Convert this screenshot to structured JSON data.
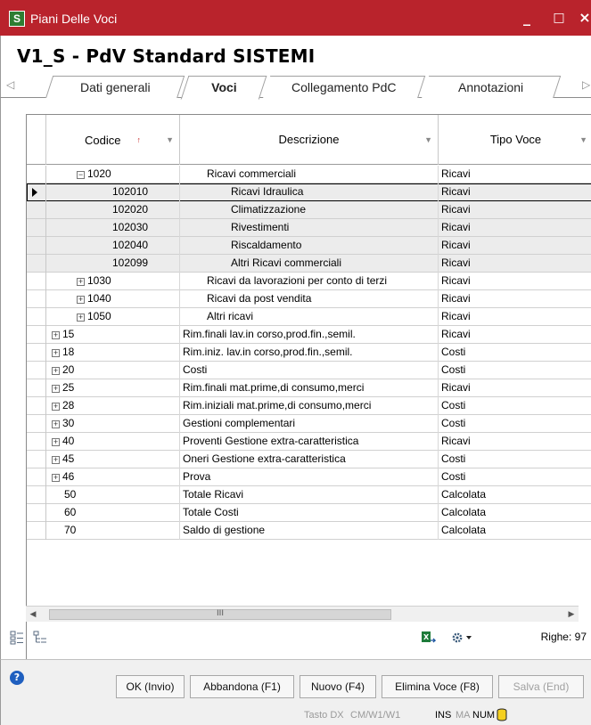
{
  "window": {
    "title": "Piani Delle Voci",
    "app_icon_letter": "S",
    "minimize": "_",
    "maximize": "□",
    "close": "×"
  },
  "heading": "V1_S - PdV Standard SISTEMI",
  "tabs": [
    {
      "label": "Dati generali",
      "active": false
    },
    {
      "label": "Voci",
      "active": true
    },
    {
      "label": "Collegamento PdC",
      "active": false
    },
    {
      "label": "Annotazioni",
      "active": false
    }
  ],
  "tabs_scroll": {
    "left": "◁",
    "right": "▷"
  },
  "grid": {
    "columns": {
      "codice": "Codice",
      "descrizione": "Descrizione",
      "tipo": "Tipo Voce"
    },
    "sort_indicator": "↑",
    "filter_indicator": "▼",
    "rows": [
      {
        "code": "1020",
        "desc": "Ricavi commerciali",
        "tipo": "Ricavi",
        "expander": "⊟",
        "level": 1,
        "child": false,
        "current": false
      },
      {
        "code": "102010",
        "desc": "Ricavi Idraulica",
        "tipo": "Ricavi",
        "expander": "",
        "level": 2,
        "child": true,
        "current": true
      },
      {
        "code": "102020",
        "desc": "Climatizzazione",
        "tipo": "Ricavi",
        "expander": "",
        "level": 2,
        "child": true,
        "current": false
      },
      {
        "code": "102030",
        "desc": "Rivestimenti",
        "tipo": "Ricavi",
        "expander": "",
        "level": 2,
        "child": true,
        "current": false
      },
      {
        "code": "102040",
        "desc": "Riscaldamento",
        "tipo": "Ricavi",
        "expander": "",
        "level": 2,
        "child": true,
        "current": false
      },
      {
        "code": "102099",
        "desc": "Altri Ricavi commerciali",
        "tipo": "Ricavi",
        "expander": "",
        "level": 2,
        "child": true,
        "current": false
      },
      {
        "code": "1030",
        "desc": "Ricavi da lavorazioni per conto di terzi",
        "tipo": "Ricavi",
        "expander": "⊞",
        "level": 1,
        "child": false,
        "current": false
      },
      {
        "code": "1040",
        "desc": "Ricavi da post vendita",
        "tipo": "Ricavi",
        "expander": "⊞",
        "level": 1,
        "child": false,
        "current": false
      },
      {
        "code": "1050",
        "desc": "Altri ricavi",
        "tipo": "Ricavi",
        "expander": "⊞",
        "level": 1,
        "child": false,
        "current": false
      },
      {
        "code": "15",
        "desc": "Rim.finali lav.in corso,prod.fin.,semil.",
        "tipo": "Ricavi",
        "expander": "⊞",
        "level": 0,
        "child": false,
        "current": false
      },
      {
        "code": "18",
        "desc": "Rim.iniz. lav.in corso,prod.fin.,semil.",
        "tipo": "Costi",
        "expander": "⊞",
        "level": 0,
        "child": false,
        "current": false
      },
      {
        "code": "20",
        "desc": "Costi",
        "tipo": "Costi",
        "expander": "⊞",
        "level": 0,
        "child": false,
        "current": false
      },
      {
        "code": "25",
        "desc": "Rim.finali mat.prime,di consumo,merci",
        "tipo": "Ricavi",
        "expander": "⊞",
        "level": 0,
        "child": false,
        "current": false
      },
      {
        "code": "28",
        "desc": "Rim.iniziali mat.prime,di consumo,merci",
        "tipo": "Costi",
        "expander": "⊞",
        "level": 0,
        "child": false,
        "current": false
      },
      {
        "code": "30",
        "desc": "Gestioni complementari",
        "tipo": "Costi",
        "expander": "⊞",
        "level": 0,
        "child": false,
        "current": false
      },
      {
        "code": "40",
        "desc": "Proventi Gestione extra-caratteristica",
        "tipo": "Ricavi",
        "expander": "⊞",
        "level": 0,
        "child": false,
        "current": false
      },
      {
        "code": "45",
        "desc": "Oneri Gestione extra-caratteristica",
        "tipo": "Costi",
        "expander": "⊞",
        "level": 0,
        "child": false,
        "current": false
      },
      {
        "code": "46",
        "desc": "Prova",
        "tipo": "Costi",
        "expander": "⊞",
        "level": 0,
        "child": false,
        "current": false
      },
      {
        "code": "50",
        "desc": "Totale Ricavi",
        "tipo": "Calcolata",
        "expander": "",
        "level": 0,
        "child": false,
        "current": false
      },
      {
        "code": "60",
        "desc": "Totale Costi",
        "tipo": "Calcolata",
        "expander": "",
        "level": 0,
        "child": false,
        "current": false
      },
      {
        "code": "70",
        "desc": "Saldo di gestione",
        "tipo": "Calcolata",
        "expander": "",
        "level": 0,
        "child": false,
        "current": false
      }
    ]
  },
  "hscroll": {
    "left": "◀",
    "right": "▶",
    "grip": "III"
  },
  "righe": "Righe: 97",
  "buttons": {
    "ok": "OK (Invio)",
    "abbandona": "Abbandona (F1)",
    "nuovo": "Nuovo (F4)",
    "elimina": "Elimina Voce (F8)",
    "salva": "Salva (End)"
  },
  "help_glyph": "?",
  "status": {
    "tasto": "Tasto DX",
    "cm": "CM/W1/W1",
    "ins": "INS",
    "ma": "MA",
    "num": "NUM"
  },
  "colors": {
    "titlebar": "#b9232c",
    "child_row": "#ececec",
    "sort": "#c62828"
  }
}
